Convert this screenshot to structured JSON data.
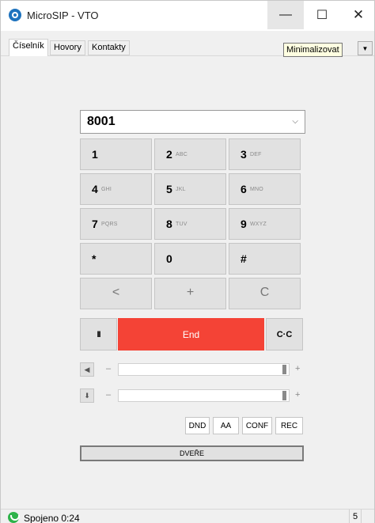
{
  "window": {
    "title": "MicroSIP - VTO",
    "minimize_glyph": "—",
    "maximize_glyph": "☐",
    "close_glyph": "✕"
  },
  "tabs": [
    {
      "label": "Číselník"
    },
    {
      "label": "Hovory"
    },
    {
      "label": "Kontakty"
    }
  ],
  "tooltip": "Minimalizovat",
  "dial": {
    "value": "8001"
  },
  "keypad": {
    "rows": [
      [
        {
          "digit": "1",
          "letters": ""
        },
        {
          "digit": "2",
          "letters": "ABC"
        },
        {
          "digit": "3",
          "letters": "DEF"
        }
      ],
      [
        {
          "digit": "4",
          "letters": "GHI"
        },
        {
          "digit": "5",
          "letters": "JKL"
        },
        {
          "digit": "6",
          "letters": "MNO"
        }
      ],
      [
        {
          "digit": "7",
          "letters": "PQRS"
        },
        {
          "digit": "8",
          "letters": "TUV"
        },
        {
          "digit": "9",
          "letters": "WXYZ"
        }
      ],
      [
        {
          "digit": "*",
          "letters": ""
        },
        {
          "digit": "0",
          "letters": ""
        },
        {
          "digit": "#",
          "letters": ""
        }
      ]
    ],
    "actions": [
      "<",
      "+",
      "C"
    ]
  },
  "call": {
    "hold": "II",
    "end": "End",
    "transfer": "C·C"
  },
  "speaker": {
    "minus": "–",
    "plus": "+",
    "level": 0.97
  },
  "microphone": {
    "minus": "–",
    "plus": "+",
    "level": 0.97
  },
  "toggles": [
    "DND",
    "AA",
    "CONF",
    "REC"
  ],
  "door_button": "DVEŘE",
  "status": {
    "text": "Spojeno 0:24",
    "count": "5"
  },
  "colors": {
    "end": "#f44336",
    "status_ok": "#2eb34a",
    "tooltip_bg": "#ffffe1"
  }
}
